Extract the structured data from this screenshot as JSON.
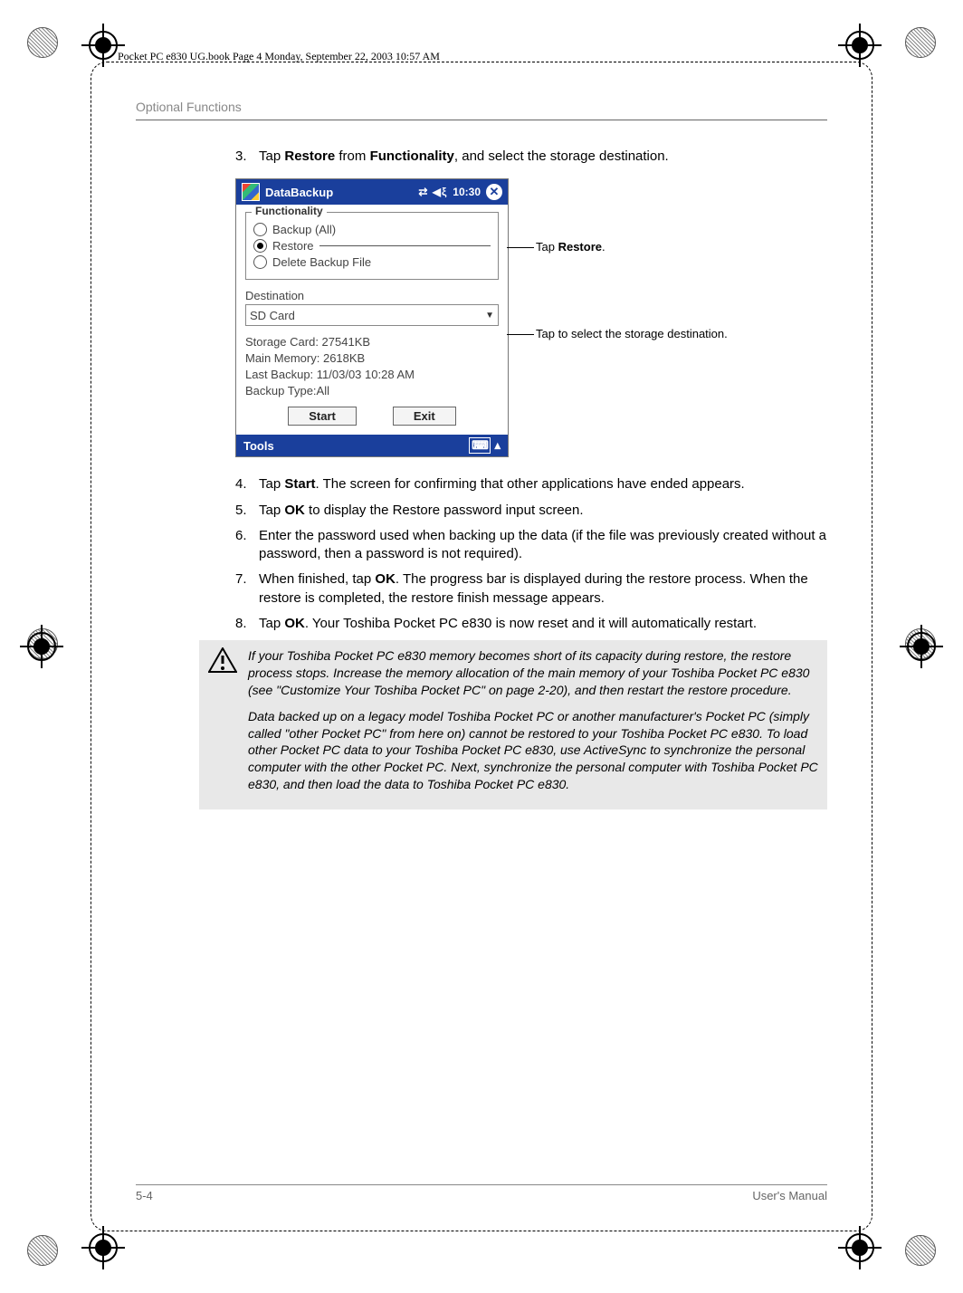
{
  "header": {
    "frame_note": "Pocket PC e830 UG.book  Page 4  Monday, September 22, 2003  10:57 AM",
    "running_head": "Optional Functions"
  },
  "steps": {
    "s3_num": "3.",
    "s3_pre": "Tap ",
    "s3_b1": "Restore",
    "s3_mid": " from ",
    "s3_b2": "Functionality",
    "s3_post": ", and select the storage destination.",
    "s4_num": "4.",
    "s4_pre": "Tap ",
    "s4_b": "Start",
    "s4_post": ". The screen for confirming that other applications have ended appears.",
    "s5_num": "5.",
    "s5_pre": "Tap ",
    "s5_b": "OK",
    "s5_post": " to display the Restore password input screen.",
    "s6_num": "6.",
    "s6_txt": "Enter the password used when backing up the data (if the file was previously created without a password, then a password is not required).",
    "s7_num": "7.",
    "s7_pre": "When finished, tap ",
    "s7_b": "OK",
    "s7_post": ". The progress bar is displayed during the restore process. When the restore is completed, the restore finish message appears.",
    "s8_num": "8.",
    "s8_pre": "Tap ",
    "s8_b": "OK",
    "s8_post": ". Your Toshiba Pocket PC e830 is now reset and it will automatically restart."
  },
  "pda": {
    "title": "DataBackup",
    "signal": "⇄ ◀ξ",
    "clock": "10:30",
    "close": "✕",
    "legend": "Functionality",
    "opt1": "Backup (All)",
    "opt2": "Restore",
    "opt3": "Delete Backup File",
    "dest_label": "Destination",
    "dest_value": "SD Card",
    "row1": "Storage Card:   27541KB",
    "row2": "Main Memory:    2618KB",
    "row3": "Last Backup:  11/03/03 10:28 AM",
    "row4": "Backup Type:All",
    "btn_start": "Start",
    "btn_exit": "Exit",
    "tools": "Tools",
    "arrow_up": "▴"
  },
  "callouts": {
    "c1_pre": "Tap ",
    "c1_b": "Restore",
    "c1_post": ".",
    "c2": "Tap to select the storage destination."
  },
  "note": {
    "p1": "If your Toshiba Pocket PC e830 memory becomes short of its capacity during restore, the restore process stops. Increase the memory allocation of the main memory of your Toshiba Pocket PC e830 (see \"Customize Your Toshiba Pocket PC\" on page 2-20), and then restart the restore procedure.",
    "p2": "Data backed up on a legacy model Toshiba Pocket PC or another manufacturer's Pocket PC (simply called \"other Pocket PC\" from here on) cannot be restored to your Toshiba Pocket PC e830. To load other Pocket PC data to your Toshiba Pocket PC e830, use ActiveSync to synchronize the personal computer with the other Pocket PC. Next, synchronize the personal computer with Toshiba Pocket PC e830, and then load the data to Toshiba Pocket PC e830."
  },
  "footer": {
    "left": "5-4",
    "right": "User's Manual"
  }
}
